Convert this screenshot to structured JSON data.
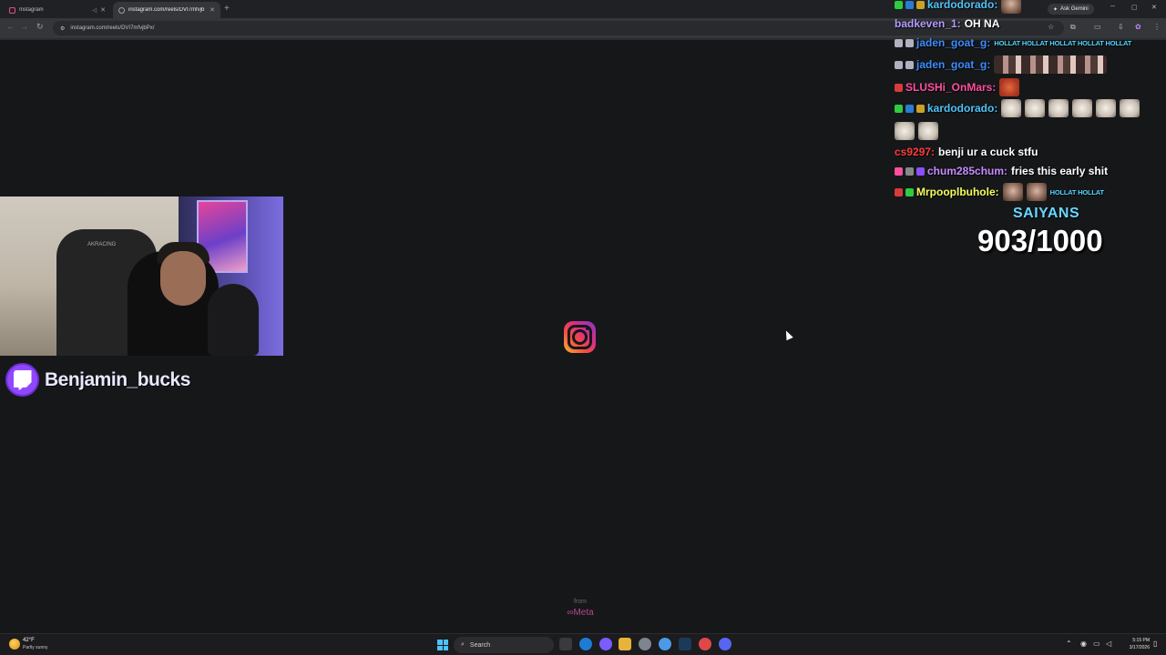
{
  "browser": {
    "tabs": [
      {
        "title": "Instagram",
        "active": false
      },
      {
        "title": "instagram.com/reels/DVI7mfvjb",
        "active": true
      }
    ],
    "gemini_label": "Ask Gemini",
    "url": "instagram.com/reels/DVI7mfvjbPx/"
  },
  "page": {
    "from_label": "from",
    "meta_label": "∞Meta"
  },
  "stream": {
    "streamer_name": "Benjamin_bucks",
    "goal_label": "SAIYANS",
    "goal_count": "903/1000"
  },
  "chat": {
    "messages": [
      {
        "user": "kardodorado:",
        "color": "#4fc3f7",
        "text": "",
        "badges": [
          "#2ecc40",
          "#2b7cd3",
          "#c9a227"
        ],
        "emotes": [
          "face"
        ]
      },
      {
        "user": "badkeven_1:",
        "color": "#b59bff",
        "text": "OH NA",
        "badges": [],
        "emotes": []
      },
      {
        "user": "jaden_goat_g:",
        "color": "#3d8cff",
        "text": "",
        "badges": [
          "#b0b0c0",
          "#b0b0c0"
        ],
        "hollat": "HOLLAT HOLLAT HOLLAT HOLLAT HOLLAT"
      },
      {
        "user": "jaden_goat_g:",
        "color": "#3d8cff",
        "text": "",
        "badges": [
          "#b0b0c0",
          "#b0b0c0"
        ],
        "emotes": [
          "dance"
        ]
      },
      {
        "user": "SLUSHi_OnMars:",
        "color": "#ff4fa0",
        "text": "",
        "badges": [
          "#d83b3b"
        ],
        "emotes": [
          "red"
        ]
      },
      {
        "user": "kardodorado:",
        "color": "#4fc3f7",
        "text": "",
        "badges": [
          "#2ecc40",
          "#2b7cd3",
          "#c9a227"
        ],
        "emotes": [
          "dog",
          "dog",
          "dog",
          "dog",
          "dog",
          "dog"
        ]
      },
      {
        "user": "",
        "color": "#ffffff",
        "text": "",
        "badges": [],
        "emotes": [
          "dog",
          "dog"
        ]
      },
      {
        "user": "cs9297:",
        "color": "#ff3b3b",
        "text": "benji ur a cuck stfu",
        "badges": [],
        "emotes": []
      },
      {
        "user": "chum285chum:",
        "color": "#c58bff",
        "text": "fries this early shit",
        "badges": [
          "#ff4fa0",
          "#888888",
          "#8a4fff"
        ],
        "emotes": []
      },
      {
        "user": "Mrpooplbuhole:",
        "color": "#f4ff5a",
        "text": "",
        "badges": [
          "#d83b3b",
          "#2ecc40"
        ],
        "emotes": [
          "face",
          "face"
        ],
        "hollat": "HOLLAT HOLLAT"
      }
    ]
  },
  "taskbar": {
    "weather_temp": "42°F",
    "weather_desc": "Partly sunny",
    "search_label": "Search",
    "time": "5:15 PM",
    "date": "3/17/2026"
  }
}
